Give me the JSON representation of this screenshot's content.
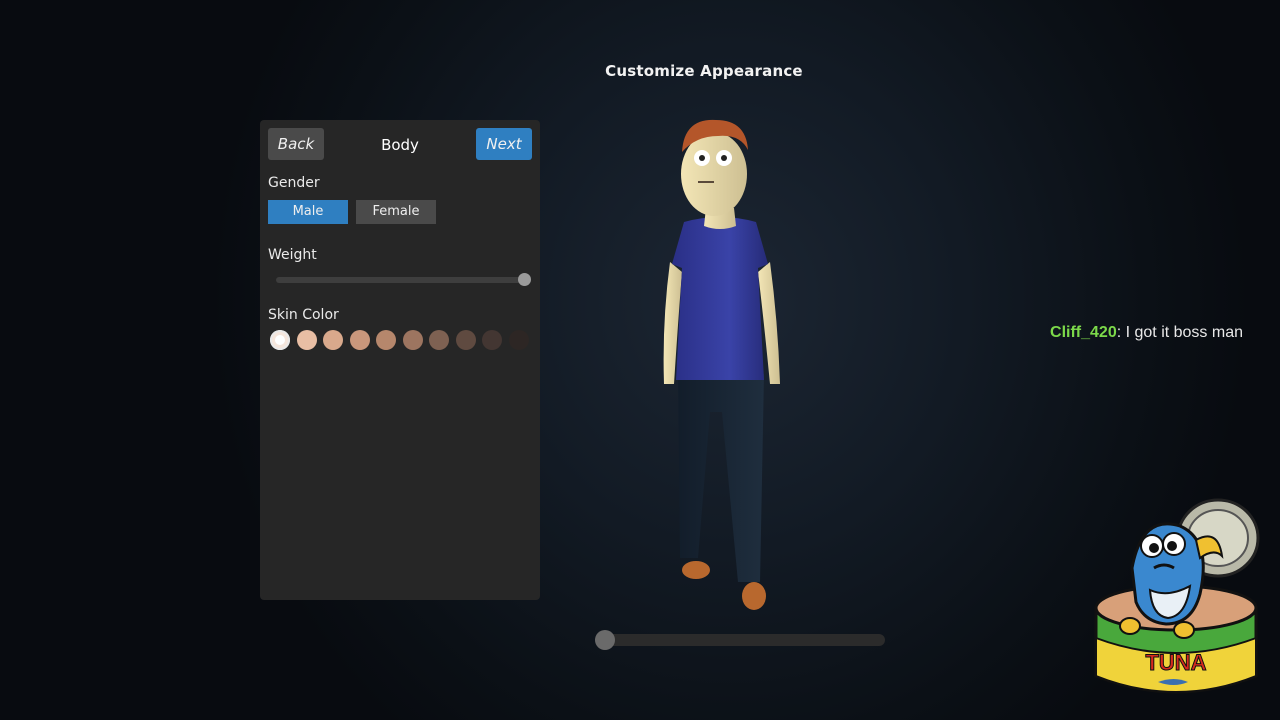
{
  "title": "Customize Appearance",
  "panel": {
    "back_label": "Back",
    "title": "Body",
    "next_label": "Next",
    "gender_label": "Gender",
    "gender_options": [
      "Male",
      "Female"
    ],
    "gender_selected": "Male",
    "weight_label": "Weight",
    "weight_value": 1.0,
    "skin_label": "Skin Color",
    "skin_colors": [
      "#f5e6dc",
      "#e8bea4",
      "#d9a98c",
      "#c9977c",
      "#b6876c",
      "#9d7560",
      "#7e6152",
      "#5f4a40",
      "#433632",
      "#2d2624"
    ],
    "skin_selected": 0
  },
  "preview_slider_value": 0.0,
  "chat": {
    "user": "Cliff_420",
    "message": "I got it boss man"
  },
  "logo": {
    "text": "TUNA"
  },
  "colors": {
    "accent": "#2f7fc1",
    "button_gray": "#4a4a4a",
    "panel_bg": "#262626",
    "chat_user": "#7cd94a"
  }
}
